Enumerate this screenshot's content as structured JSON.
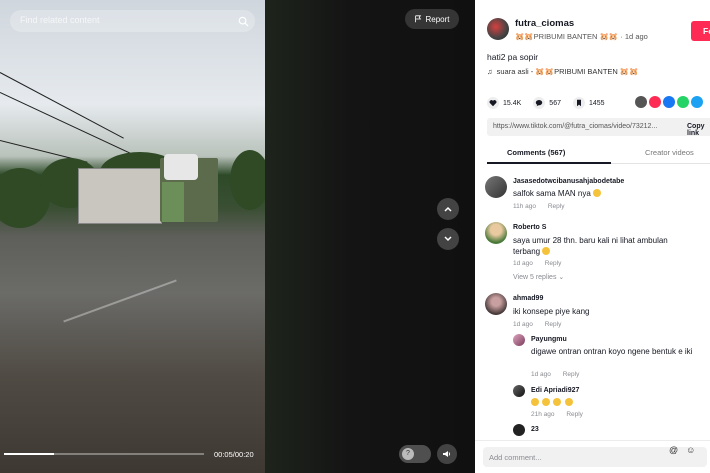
{
  "video": {
    "search_placeholder": "Find related content",
    "report_label": "Report",
    "time": "00:05/00:20",
    "progress_fraction": 0.25
  },
  "post": {
    "username": "futra_ciomas",
    "nickname": "🐹🐹PRIBUMI BANTEN 🐹🐹",
    "date": "1d ago",
    "follow_label": "Follow",
    "caption": "hati2 pa sopir",
    "sound": "suara asli - 🐹🐹PRIBUMI BANTEN 🐹🐹",
    "likes": "15.4K",
    "comments": "567",
    "saves": "1455",
    "link": "https://www.tiktok.com/@futra_ciomas/video/73212...",
    "copy_label": "Copy link"
  },
  "tabs": {
    "comments": "Comments (567)",
    "creator_videos": "Creator videos"
  },
  "comments": [
    {
      "name": "Jasasedotwcibanusahjabodetabe",
      "text": "salfok sama MAN nya",
      "emoji": true,
      "time": "11h ago",
      "reply": "Reply"
    },
    {
      "name": "Roberto S",
      "text": "saya umur 28 thn. baru kali ni lihat ambulan terbang",
      "emoji": true,
      "time": "1d ago",
      "reply": "Reply",
      "view_replies": "View 5 replies"
    },
    {
      "name": "ahmad99",
      "text": "iki konsepe piye kang",
      "time": "1d ago",
      "reply": "Reply"
    },
    {
      "name": "Payungmu",
      "text": "digawe ontran ontran koyo ngene bentuk e iki",
      "time": "1d ago",
      "reply": "Reply"
    },
    {
      "name": "Edi Apriadi927",
      "time": "21h ago",
      "reply": "Reply"
    }
  ],
  "partial_name": "23",
  "add_comment": {
    "placeholder": "Add comment...",
    "at_icon": "@",
    "emoji_icon": "☺"
  },
  "colors": {
    "follow": "#fe2c55",
    "share": [
      "#555555",
      "#fe2c55",
      "#1877f2",
      "#25d366",
      "#1da1f2"
    ]
  }
}
